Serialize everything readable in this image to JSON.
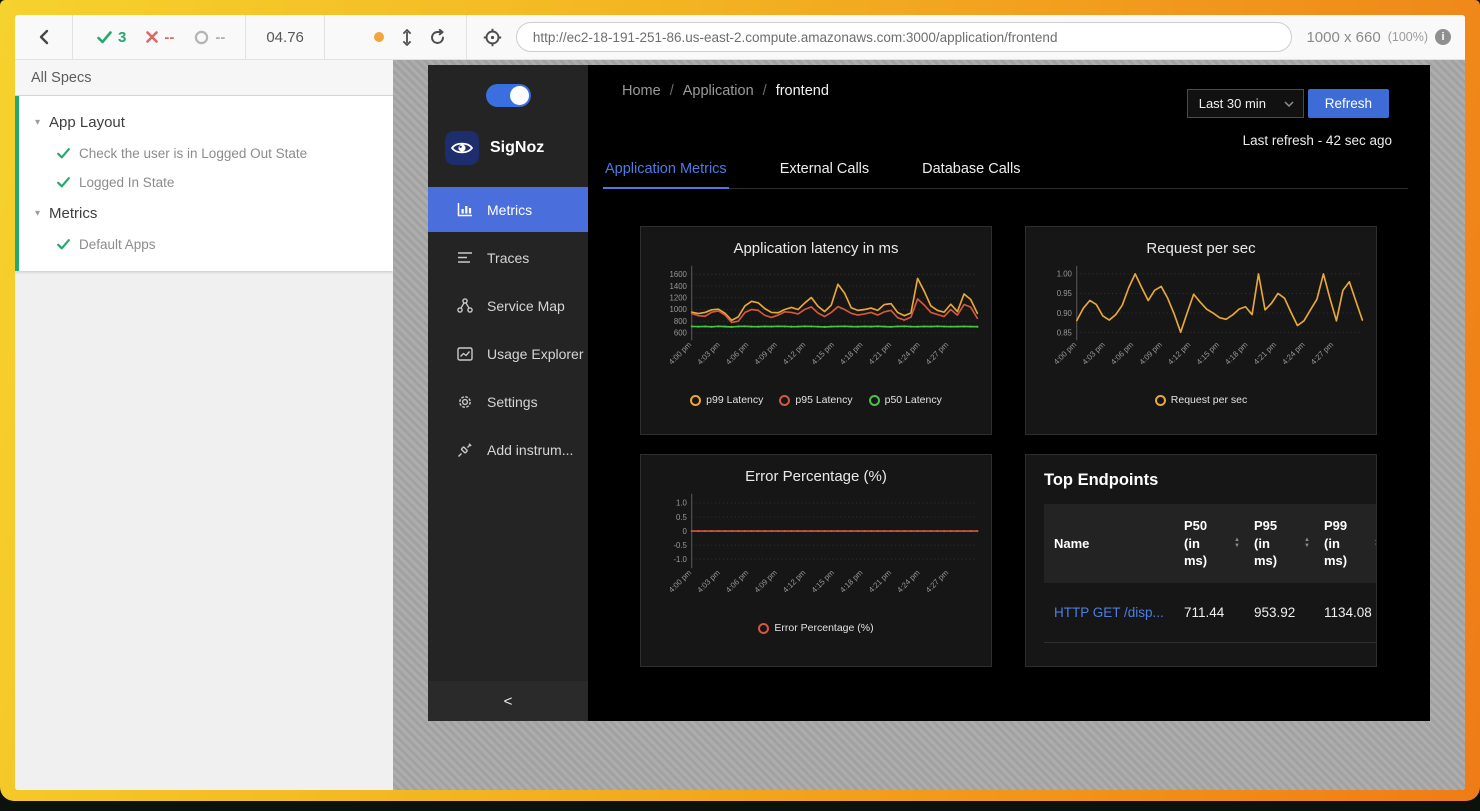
{
  "colors": {
    "pass": "#26a871",
    "fail": "#d65050",
    "accent": "#4a6fdc",
    "toggle": "#3a6fe0",
    "refresh": "#3e6cd6",
    "tab": "#4c7be8",
    "link": "#4c7fe0",
    "frame_yellow": "#f6d22d",
    "frame_orange": "#ef7c17"
  },
  "cypress": {
    "toolbar": {
      "passed_count": "3",
      "failed_count": "--",
      "pending_count": "--",
      "duration": "04.76",
      "url": "http://ec2-18-191-251-86.us-east-2.compute.amazonaws.com:3000/application/frontend",
      "viewport_size": "1000 x 660",
      "viewport_zoom": "(100%)"
    },
    "specs": {
      "header": "All Specs",
      "suites": [
        {
          "title": "App Layout",
          "tests": [
            "Check the user is in Logged Out State",
            "Logged In State"
          ]
        },
        {
          "title": "Metrics",
          "tests": [
            "Default Apps"
          ]
        }
      ]
    }
  },
  "app": {
    "brand": "SigNoz",
    "nav": [
      {
        "label": "Metrics"
      },
      {
        "label": "Traces"
      },
      {
        "label": "Service Map"
      },
      {
        "label": "Usage Explorer"
      },
      {
        "label": "Settings"
      },
      {
        "label": "Add instrum..."
      }
    ],
    "collapse_glyph": "<",
    "breadcrumb": {
      "items": [
        "Home",
        "Application",
        "frontend"
      ],
      "separator": "/"
    },
    "time_range": "Last 30 min",
    "refresh_label": "Refresh",
    "last_refresh": "Last refresh - 42 sec ago",
    "tabs": [
      {
        "label": "Application Metrics"
      },
      {
        "label": "External Calls"
      },
      {
        "label": "Database Calls"
      }
    ]
  },
  "chart_data": [
    {
      "type": "line",
      "title": "Application latency in ms",
      "ylim": [
        560,
        1660
      ],
      "yticks": [
        600,
        800,
        1000,
        1200,
        1400,
        1600
      ],
      "xlabels": [
        "4:00 pm",
        "4:03 pm",
        "4:06 pm",
        "4:09 pm",
        "4:12 pm",
        "4:15 pm",
        "4:18 pm",
        "4:21 pm",
        "4:24 pm",
        "4:27 pm"
      ],
      "legend_position": "bottom",
      "series": [
        {
          "name": "p99 Latency",
          "color": "#e8a838",
          "markers": false,
          "values": [
            955,
            930,
            950,
            995,
            1005,
            935,
            815,
            875,
            1060,
            1140,
            1115,
            1015,
            950,
            945,
            1000,
            1035,
            1000,
            1110,
            1205,
            1055,
            965,
            1075,
            1430,
            1280,
            1030,
            985,
            1000,
            1025,
            985,
            1085,
            1100,
            950,
            895,
            940,
            1530,
            1310,
            1060,
            985,
            955,
            1090,
            965,
            1265,
            1170,
            935
          ]
        },
        {
          "name": "p95 Latency",
          "color": "#d4573f",
          "markers": false,
          "values": [
            930,
            895,
            885,
            955,
            975,
            905,
            780,
            800,
            950,
            1000,
            985,
            900,
            865,
            905,
            960,
            950,
            925,
            1000,
            1045,
            940,
            880,
            950,
            1050,
            1000,
            935,
            905,
            925,
            950,
            905,
            960,
            985,
            860,
            820,
            870,
            1180,
            1075,
            950,
            915,
            880,
            1000,
            905,
            1085,
            1040,
            850
          ]
        },
        {
          "name": "p50 Latency",
          "color": "#45c445",
          "markers": true,
          "values": [
            712,
            707,
            711,
            705,
            713,
            709,
            704,
            711,
            714,
            708,
            706,
            712,
            709,
            714,
            711,
            706,
            709,
            713,
            711,
            707,
            704,
            709,
            711,
            714,
            709,
            706,
            711,
            708,
            713,
            709,
            705,
            711,
            714,
            708,
            706,
            711,
            709,
            713,
            710,
            707,
            709,
            711,
            708,
            706
          ]
        }
      ]
    },
    {
      "type": "line",
      "title": "Request per sec",
      "ylim": [
        0.843,
        1.008
      ],
      "yticks": [
        0.85,
        0.9,
        0.95,
        1.0
      ],
      "ytick_labels": [
        "0.85",
        "0.90",
        "0.95",
        "1.00"
      ],
      "xlabels": [
        "4:00 pm",
        "4:03 pm",
        "4:06 pm",
        "4:09 pm",
        "4:12 pm",
        "4:15 pm",
        "4:18 pm",
        "4:21 pm",
        "4:24 pm",
        "4:27 pm"
      ],
      "legend_position": "bottom",
      "series": [
        {
          "name": "Request per sec",
          "color": "#e8a838",
          "markers": false,
          "values": [
            0.881,
            0.912,
            0.932,
            0.922,
            0.893,
            0.882,
            0.896,
            0.92,
            0.965,
            1.0,
            0.965,
            0.932,
            0.958,
            0.968,
            0.938,
            0.898,
            0.851,
            0.9,
            0.948,
            0.928,
            0.91,
            0.9,
            0.888,
            0.884,
            0.895,
            0.91,
            0.916,
            0.896,
            1.0,
            0.908,
            0.925,
            0.95,
            0.938,
            0.902,
            0.868,
            0.88,
            0.908,
            0.935,
            1.0,
            0.938,
            0.88,
            0.958,
            0.98,
            0.93,
            0.882
          ]
        }
      ]
    },
    {
      "type": "line",
      "title": "Error Percentage (%)",
      "ylim": [
        -1.15,
        1.15
      ],
      "yticks": [
        -1.0,
        -0.5,
        0,
        0.5,
        1.0
      ],
      "ytick_labels": [
        "-1.0",
        "-0.5",
        "0",
        "0.5",
        "1.0"
      ],
      "xlabels": [
        "4:00 pm",
        "4:03 pm",
        "4:06 pm",
        "4:09 pm",
        "4:12 pm",
        "4:15 pm",
        "4:18 pm",
        "4:21 pm",
        "4:24 pm",
        "4:27 pm"
      ],
      "legend_position": "bottom",
      "series": [
        {
          "name": "Error Percentage (%)",
          "color": "#d4573f",
          "markers": true,
          "values": [
            0,
            0,
            0,
            0,
            0,
            0,
            0,
            0,
            0,
            0,
            0,
            0,
            0,
            0,
            0,
            0,
            0,
            0,
            0,
            0,
            0,
            0,
            0,
            0,
            0,
            0,
            0,
            0,
            0,
            0,
            0,
            0,
            0,
            0,
            0,
            0,
            0,
            0,
            0,
            0,
            0,
            0,
            0,
            0
          ]
        }
      ]
    },
    {
      "type": "table",
      "title": "Top Endpoints",
      "columns": [
        "Name",
        "P50 (in ms)",
        "P95 (in ms)",
        "P99 (in ms)"
      ],
      "rows": [
        {
          "name": "HTTP GET /disp...",
          "p50": "711.44",
          "p95": "953.92",
          "p99": "1134.08"
        }
      ]
    }
  ]
}
